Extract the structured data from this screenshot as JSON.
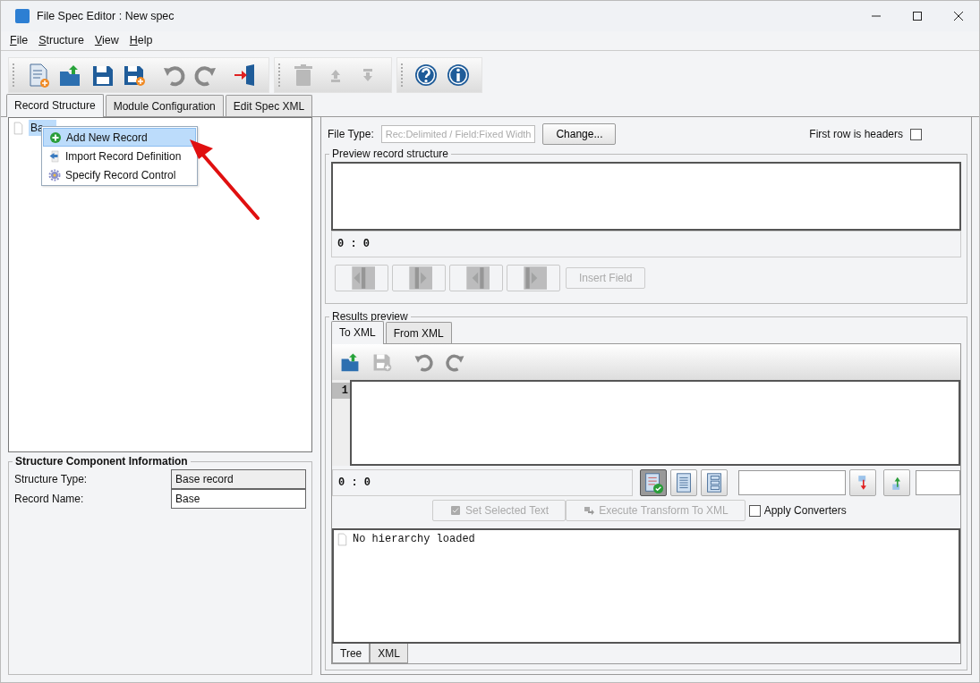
{
  "window": {
    "title": "File Spec Editor : New spec"
  },
  "menu": [
    "File",
    "Structure",
    "View",
    "Help"
  ],
  "toolbar_groups": [
    [
      {
        "kind": "new-file",
        "disabled": false
      },
      {
        "kind": "open",
        "disabled": false
      },
      {
        "kind": "save",
        "disabled": false
      },
      {
        "kind": "save-as",
        "disabled": false
      },
      {
        "kind": "undo",
        "disabled": false
      },
      {
        "kind": "redo",
        "disabled": false
      },
      {
        "kind": "exit",
        "disabled": false
      }
    ],
    [
      {
        "kind": "delete",
        "disabled": true
      },
      {
        "kind": "up",
        "disabled": true
      },
      {
        "kind": "down",
        "disabled": true
      }
    ],
    [
      {
        "kind": "help",
        "disabled": false
      },
      {
        "kind": "info",
        "disabled": false
      }
    ]
  ],
  "tabs": [
    {
      "label": "Record Structure",
      "selected": true
    },
    {
      "label": "Module Configuration",
      "selected": false
    },
    {
      "label": "Edit Spec XML",
      "selected": false
    }
  ],
  "tree": {
    "items": [
      {
        "label": "Ba",
        "selected": true
      }
    ]
  },
  "context_menu": {
    "items": [
      {
        "label": "Add New Record",
        "kind": "add",
        "selected": true
      },
      {
        "label": "Import Record Definition",
        "kind": "import",
        "selected": false
      },
      {
        "label": "Specify Record Control",
        "kind": "control",
        "selected": false
      }
    ]
  },
  "structure_info": {
    "title": "Structure Component Information",
    "fields": [
      {
        "label": "Structure Type:",
        "value": "Base record",
        "editable": false
      },
      {
        "label": "Record Name:",
        "value": "Base",
        "editable": true
      }
    ]
  },
  "file_type": {
    "label": "File Type:",
    "value": "Rec:Delimited / Field:Fixed Width",
    "disabled": true,
    "button": "Change..."
  },
  "first_row_headers": {
    "label": "First row is headers",
    "checked": false
  },
  "preview": {
    "title": "Preview record structure",
    "position": "0 : 0",
    "nav_buttons": [
      {
        "kind": "left-bar",
        "disabled": true
      },
      {
        "kind": "bar-right",
        "disabled": true
      },
      {
        "kind": "left-bar-end",
        "disabled": true
      },
      {
        "kind": "bar-right-end",
        "disabled": true
      }
    ],
    "insert_button": {
      "label": "Insert Field",
      "disabled": true
    }
  },
  "results": {
    "title": "Results preview",
    "tabs": [
      {
        "label": "To XML",
        "selected": true
      },
      {
        "label": "From XML",
        "selected": false
      }
    ],
    "toolbar": [
      {
        "kind": "open",
        "disabled": false
      },
      {
        "kind": "save-as",
        "disabled": true
      },
      {
        "kind": "undo",
        "disabled": false
      },
      {
        "kind": "redo",
        "disabled": false
      }
    ],
    "line_numbers": [
      "1"
    ],
    "position": "0 : 0",
    "view_buttons": [
      {
        "kind": "validated",
        "selected": true
      },
      {
        "kind": "document",
        "selected": false
      },
      {
        "kind": "list",
        "selected": false
      }
    ],
    "search_buttons": [
      {
        "kind": "down"
      },
      {
        "kind": "up"
      }
    ],
    "actions": [
      {
        "label": "Set Selected Text",
        "kind": "select",
        "disabled": true
      },
      {
        "label": "Execute Transform To XML",
        "kind": "transform",
        "disabled": true
      }
    ],
    "apply_converters": {
      "label": "Apply Converters",
      "checked": false
    },
    "tree_message": "No hierarchy loaded",
    "bottom_tabs": [
      {
        "label": "Tree",
        "selected": true
      },
      {
        "label": "XML",
        "selected": false
      }
    ]
  }
}
